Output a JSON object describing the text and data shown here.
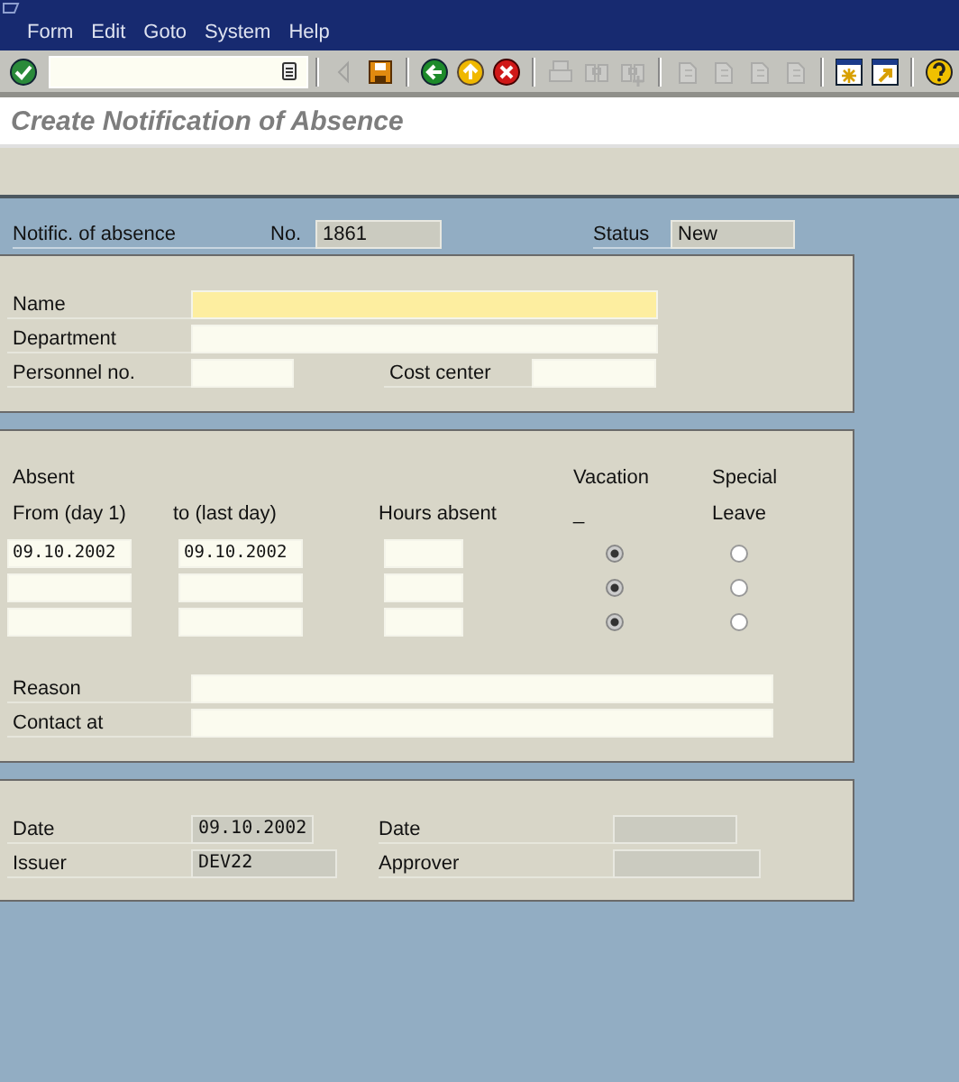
{
  "menu": [
    "Form",
    "Edit",
    "Goto",
    "System",
    "Help"
  ],
  "toolbar": [
    {
      "kind": "enter",
      "disabled": false
    },
    {
      "kind": "command"
    },
    {
      "kind": "sep"
    },
    {
      "kind": "prev",
      "disabled": true
    },
    {
      "kind": "save",
      "disabled": false
    },
    {
      "kind": "sep"
    },
    {
      "kind": "back",
      "disabled": false
    },
    {
      "kind": "exit",
      "disabled": false
    },
    {
      "kind": "cancel",
      "disabled": false
    },
    {
      "kind": "sep"
    },
    {
      "kind": "print",
      "disabled": true
    },
    {
      "kind": "find",
      "disabled": true
    },
    {
      "kind": "findnext",
      "disabled": true
    },
    {
      "kind": "sep"
    },
    {
      "kind": "first",
      "disabled": true
    },
    {
      "kind": "prevpage",
      "disabled": true
    },
    {
      "kind": "nextpage",
      "disabled": true
    },
    {
      "kind": "last",
      "disabled": true
    },
    {
      "kind": "sep"
    },
    {
      "kind": "session",
      "disabled": false
    },
    {
      "kind": "shortcut",
      "disabled": false
    },
    {
      "kind": "sep"
    },
    {
      "kind": "help",
      "disabled": false
    }
  ],
  "title": "Create Notification of Absence",
  "header": {
    "label": "Notific. of absence",
    "no_label": "No.",
    "no": "1861",
    "status_label": "Status",
    "status": "New"
  },
  "person": {
    "name_label": "Name",
    "department_label": "Department",
    "personnel_label": "Personnel no.",
    "cost_center_label": "Cost center"
  },
  "absence": {
    "title": "Absent",
    "from_label": "From (day 1)",
    "to_label": "to (last day)",
    "hours_label": "Hours absent",
    "vacation_label": "Vacation",
    "vacation_mark": "_",
    "special_label": "Special",
    "special_label_2": "Leave",
    "rows": [
      {
        "from": "09.10.2002",
        "to": "09.10.2002",
        "options": [
          {
            "selected": true
          },
          {
            "selected": false
          }
        ]
      },
      {
        "options": [
          {
            "selected": true
          },
          {
            "selected": false
          }
        ]
      },
      {
        "options": [
          {
            "selected": true
          },
          {
            "selected": false
          }
        ]
      }
    ],
    "reason_label": "Reason",
    "contact_label": "Contact at"
  },
  "approval": {
    "date_label": "Date",
    "date": "09.10.2002",
    "issuer_label": "Issuer",
    "issuer": "DEV22",
    "approver_date_label": "Date",
    "approver_label": "Approver"
  }
}
